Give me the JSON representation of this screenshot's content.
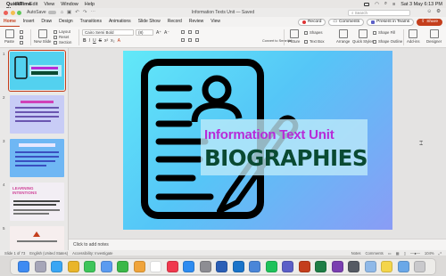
{
  "menubar": {
    "apple_glyph": "",
    "items": [
      "QuickTime Player",
      "File",
      "Edit",
      "View",
      "Window",
      "Help"
    ],
    "clock": "Sat 3 May 6:13 PM"
  },
  "titlebar": {
    "autosave_label": "AutoSave",
    "document_title": "Information Texts Unit — Saved",
    "search_placeholder": "Search"
  },
  "tabs": {
    "items": [
      "Home",
      "Insert",
      "Draw",
      "Design",
      "Transitions",
      "Animations",
      "Slide Show",
      "Record",
      "Review",
      "View"
    ],
    "active": "Home",
    "record_button": "Record",
    "comments_button": "Comments",
    "present_teams_button": "Present in Teams",
    "share_button": "Share"
  },
  "ribbon": {
    "paste": "Paste",
    "new_slide": "New Slide",
    "layout": "Layout",
    "reset": "Reset",
    "section": "Section",
    "font_name": "Cairo Semi Bold",
    "font_size": "(8)",
    "format_glyphs": [
      "B",
      "I",
      "U",
      "S",
      "x²",
      "x₂"
    ],
    "picture": "Picture",
    "shapes": "Shapes",
    "text_box": "Text Box",
    "arrange": "Arrange",
    "quick_styles": "Quick Styles",
    "shape_fill": "Shape Fill",
    "shape_outline": "Shape Outline",
    "convert_smartart": "Convert to SmartArt",
    "add_ins": "Add-ins",
    "designer": "Designer"
  },
  "thumbnails": [
    {
      "number": "1",
      "selected": true,
      "bg": "#53d1ef"
    },
    {
      "number": "2",
      "selected": false,
      "bg": "#c8ccf6"
    },
    {
      "number": "3",
      "selected": false,
      "bg": "#6fb7f4"
    },
    {
      "number": "4",
      "selected": false,
      "bg": "#f2eef4",
      "texts": [
        "LEARNING",
        "INTENTIONS"
      ]
    },
    {
      "number": "5",
      "selected": false,
      "bg": "#f6eeee"
    }
  ],
  "slide": {
    "title_line_1": "Information Text Unit",
    "title_line_2": "BIOGRAPHIES",
    "colors": {
      "title_line_1": "#b72bd8",
      "title_line_2": "#0a4a32",
      "gradient": [
        "#62e9f8",
        "#55c6f7",
        "#8a9cf5"
      ]
    }
  },
  "notes_placeholder": "Click to add notes",
  "status": {
    "slide_counter": "Slide 1 of 73",
    "language": "English (United States)",
    "accessibility": "Accessibility: Investigate",
    "notes": "Notes",
    "comments": "Comments",
    "zoom": "104%"
  },
  "dock_apps": [
    {
      "name": "finder-icon",
      "color": "#3e8bf2"
    },
    {
      "name": "launchpad-icon",
      "color": "#a6a6b8"
    },
    {
      "name": "safari-icon",
      "color": "#3aa6f4"
    },
    {
      "name": "chrome-icon",
      "color": "#e9b52b"
    },
    {
      "name": "messages-icon",
      "color": "#3ec55a"
    },
    {
      "name": "mail-icon",
      "color": "#5b9bf0"
    },
    {
      "name": "facetime-icon",
      "color": "#3bb848"
    },
    {
      "name": "photos-icon",
      "color": "#f0a43a"
    },
    {
      "name": "calendar-icon",
      "color": "#ffffff"
    },
    {
      "name": "music-icon",
      "color": "#f0384d"
    },
    {
      "name": "appstore-icon",
      "color": "#2e8cf0"
    },
    {
      "name": "settings-icon",
      "color": "#8d8d93"
    },
    {
      "name": "word-icon",
      "color": "#2b5fb6"
    },
    {
      "name": "outlook-icon",
      "color": "#1a74c9"
    },
    {
      "name": "onedrive-icon",
      "color": "#4a86d8"
    },
    {
      "name": "spotify-icon",
      "color": "#1ec25a"
    },
    {
      "name": "teams-icon",
      "color": "#5b5fc7"
    },
    {
      "name": "powerpoint-icon",
      "color": "#c43e1c"
    },
    {
      "name": "excel-icon",
      "color": "#1e7d45"
    },
    {
      "name": "onenote-icon",
      "color": "#7a3fb0"
    },
    {
      "name": "quicktime-icon",
      "color": "#555a63"
    },
    {
      "name": "preview-icon",
      "color": "#8fb9e8"
    },
    {
      "name": "notes-icon",
      "color": "#f4d54a"
    },
    {
      "name": "downloads-icon",
      "color": "#6aa8e8"
    },
    {
      "name": "trash-icon",
      "color": "#c9c9cc"
    }
  ]
}
